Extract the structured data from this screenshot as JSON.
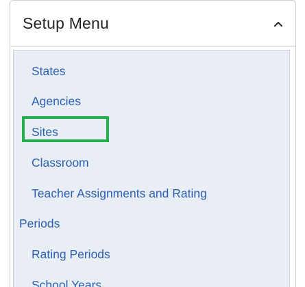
{
  "menu": {
    "title": "Setup Menu",
    "toggle_icon": "chevron-up-icon",
    "items": [
      {
        "label": "States",
        "level": "sub"
      },
      {
        "label": "Agencies",
        "level": "sub"
      },
      {
        "label": "Sites",
        "level": "sub",
        "highlighted": true
      },
      {
        "label": "Classroom",
        "level": "sub"
      },
      {
        "label": "Teacher Assignments and Rating",
        "level": "sub"
      },
      {
        "label": "Periods",
        "level": "top"
      },
      {
        "label": "Rating Periods",
        "level": "sub"
      },
      {
        "label": "School Years",
        "level": "sub"
      }
    ]
  },
  "colors": {
    "link": "#2b5fb3",
    "highlight_box": "#22b14c",
    "menu_background": "#e9eef4"
  }
}
